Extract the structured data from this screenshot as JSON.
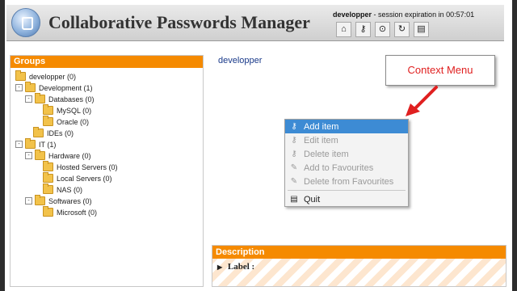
{
  "header": {
    "title": "Collaborative Passwords Manager",
    "user": "developper",
    "session_text": "- session expiration in",
    "session_time": "00:57:01",
    "toolbar_icons": [
      "home-icon",
      "key-icon",
      "binoculars-icon",
      "refresh-icon",
      "book-icon"
    ]
  },
  "groups_panel": {
    "title": "Groups",
    "items": [
      {
        "label": "developper (0)",
        "expander": "",
        "level": 0
      },
      {
        "label": "Development (1)",
        "expander": "-",
        "level": 0
      },
      {
        "label": "Databases (0)",
        "expander": "-",
        "level": 1
      },
      {
        "label": "MySQL (0)",
        "expander": "",
        "level": 2
      },
      {
        "label": "Oracle (0)",
        "expander": "",
        "level": 2
      },
      {
        "label": "IDEs (0)",
        "expander": "",
        "level": 1
      },
      {
        "label": "IT (1)",
        "expander": "-",
        "level": 0
      },
      {
        "label": "Hardware (0)",
        "expander": "-",
        "level": 1
      },
      {
        "label": "Hosted Servers (0)",
        "expander": "",
        "level": 2
      },
      {
        "label": "Local Servers (0)",
        "expander": "",
        "level": 2
      },
      {
        "label": "NAS (0)",
        "expander": "",
        "level": 2
      },
      {
        "label": "Softwares (0)",
        "expander": "-",
        "level": 1
      },
      {
        "label": "Microsoft (0)",
        "expander": "",
        "level": 2
      }
    ]
  },
  "main": {
    "user_label": "developper",
    "callout": "Context Menu"
  },
  "context_menu": {
    "items": [
      {
        "label": "Add item",
        "state": "active",
        "icon": "key-add-icon"
      },
      {
        "label": "Edit item",
        "state": "disabled",
        "icon": "key-edit-icon"
      },
      {
        "label": "Delete item",
        "state": "disabled",
        "icon": "key-delete-icon"
      },
      {
        "label": "Add to Favourites",
        "state": "disabled",
        "icon": "favourite-add-icon"
      },
      {
        "label": "Delete from Favourites",
        "state": "disabled",
        "icon": "favourite-delete-icon"
      },
      {
        "label": "Quit",
        "state": "enabled",
        "icon": "quit-icon"
      }
    ]
  },
  "description": {
    "title": "Description",
    "label_field": "Label :"
  },
  "colors": {
    "accent": "#f58a00",
    "link": "#1a3a8a",
    "menu_highlight": "#3d8bd4",
    "callout_text": "#e02020"
  }
}
